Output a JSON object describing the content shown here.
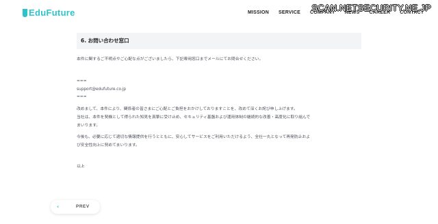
{
  "header": {
    "logo_mark": "J",
    "logo_text": "EduFuture",
    "nav": [
      "MISSION",
      "SERVICE",
      "COMPANY",
      "NEWS",
      "CAREER",
      "CONTACT"
    ]
  },
  "watermark": "SCAN.NETSECURITY.NE.JP",
  "content": {
    "heading": "6. お問い合わせ窓口",
    "intro": "本件に関するご不明点やご心配な点がございましたら、下記専用窓口までメールにてお問合せください。",
    "divider_top": "===",
    "email": "support@edufuture.co.jp",
    "divider_bottom": "===",
    "apology_lines": [
      "改めまして、本件により、関係者の皆さまにご心配とご負担をおかけしておりますことを、改めて深くお詫び申し上げます。",
      "当社は、本件を契機として得られた知見を真摯に受け止め、セキュリティ基盤および運用体制の継続的な改善・高度化に取り組んで",
      "まいります。"
    ],
    "future_lines": [
      "今後も、必要に応じて適切な情報提供を行うとともに、安心してサービスをご利用いただけるよう、全社一丸となって再発防止およ",
      "び安全性向上に努めてまいります。"
    ],
    "closing": "以上"
  },
  "pagination": {
    "prev_icon": "chevron-left-icon",
    "prev_label": "PREV"
  },
  "colors": {
    "accent": "#2ec3ca",
    "heading_bg": "#f3f4f6",
    "text": "#4a4f58"
  }
}
